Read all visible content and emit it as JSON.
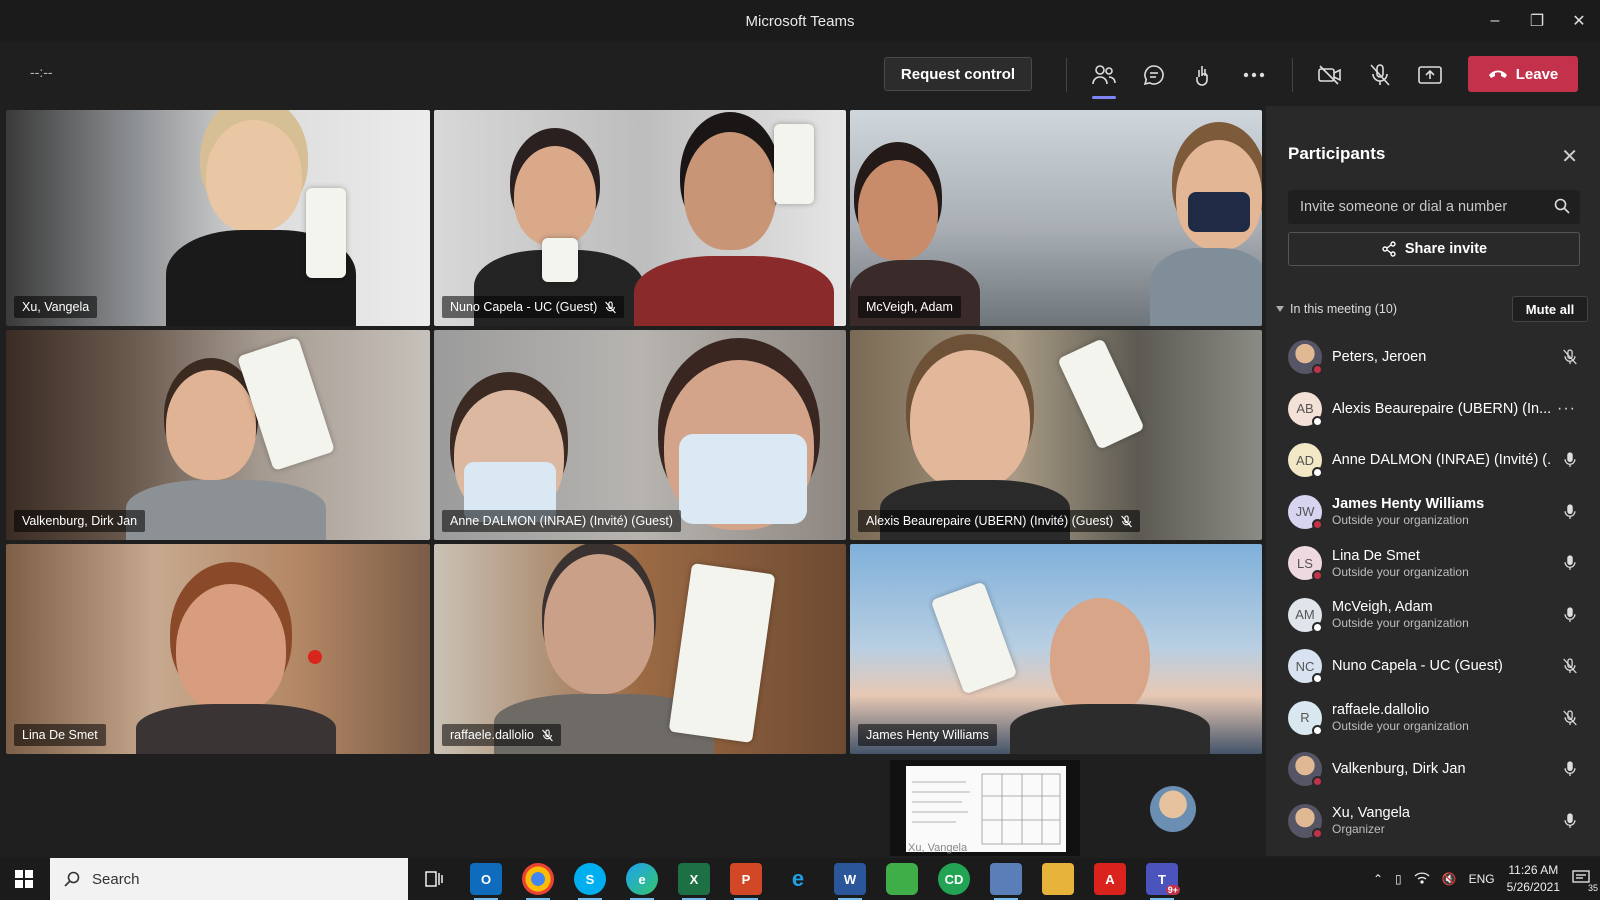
{
  "window": {
    "title": "Microsoft Teams"
  },
  "toolbar": {
    "timer": "--:--",
    "request_control": "Request control",
    "leave": "Leave"
  },
  "tiles": [
    {
      "name": "Xu, Vangela",
      "muted": false
    },
    {
      "name": "Nuno Capela - UC (Guest)",
      "muted": true
    },
    {
      "name": "McVeigh, Adam",
      "muted": false
    },
    {
      "name": "Valkenburg, Dirk Jan",
      "muted": false
    },
    {
      "name": "Anne DALMON (INRAE) (Invité) (Guest)",
      "muted": false
    },
    {
      "name": "Alexis Beaurepaire (UBERN) (Invité) (Guest)",
      "muted": true
    },
    {
      "name": "Lina De Smet",
      "muted": false
    },
    {
      "name": "raffaele.dallolio",
      "muted": true
    },
    {
      "name": "James Henty Williams",
      "muted": false
    }
  ],
  "shared_content": {
    "presenter": "Xu, Vangela"
  },
  "participants_panel": {
    "title": "Participants",
    "invite_placeholder": "Invite someone or dial a number",
    "share_invite": "Share invite",
    "section": "In this meeting (10)",
    "mute_all": "Mute all",
    "people": [
      {
        "name": "Peters, Jeroen",
        "sub": "",
        "initials": "",
        "mic": "muted",
        "status": "#c4314b"
      },
      {
        "name": "Alexis Beaurepaire (UBERN) (In...",
        "sub": "",
        "initials": "AB",
        "mic": "more",
        "status": "#ffffff"
      },
      {
        "name": "Anne DALMON (INRAE) (Invité) (...",
        "sub": "",
        "initials": "AD",
        "mic": "on",
        "status": "#ffffff"
      },
      {
        "name": "James Henty Williams",
        "sub": "Outside your organization",
        "initials": "JW",
        "mic": "on",
        "status": "#c4314b"
      },
      {
        "name": "Lina De Smet",
        "sub": "Outside your organization",
        "initials": "LS",
        "mic": "on",
        "status": "#c4314b"
      },
      {
        "name": "McVeigh, Adam",
        "sub": "Outside your organization",
        "initials": "AM",
        "mic": "on",
        "status": "#ffffff"
      },
      {
        "name": "Nuno Capela - UC (Guest)",
        "sub": "",
        "initials": "NC",
        "mic": "muted",
        "status": "#ffffff"
      },
      {
        "name": "raffaele.dallolio",
        "sub": "Outside your organization",
        "initials": "R",
        "mic": "muted",
        "status": "#ffffff"
      },
      {
        "name": "Valkenburg, Dirk Jan",
        "sub": "",
        "initials": "",
        "mic": "on",
        "status": "#c4314b"
      },
      {
        "name": "Xu, Vangela",
        "sub": "Organizer",
        "initials": "",
        "mic": "on",
        "status": "#c4314b"
      }
    ]
  },
  "taskbar": {
    "search": "Search",
    "teams_badge": "9+",
    "lang": "ENG",
    "time": "11:26 AM",
    "date": "5/26/2021",
    "notifications": "35"
  },
  "colors": {
    "leave": "#c4314b",
    "accent": "#7f85f5",
    "panel": "#292929"
  }
}
